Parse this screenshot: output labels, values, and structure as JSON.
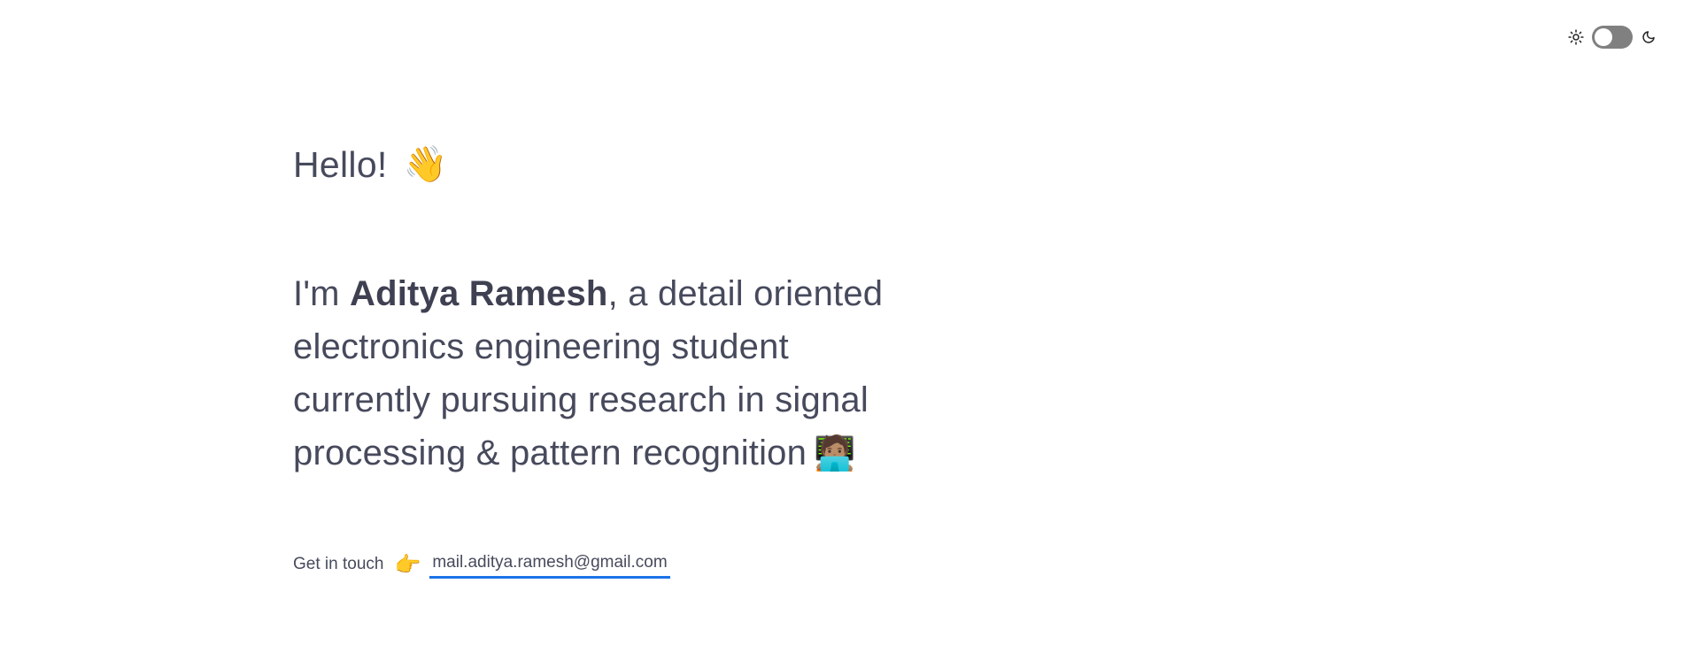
{
  "theme_toggle": {
    "light_icon": "sun-icon",
    "dark_icon": "moon-icon",
    "state": "light"
  },
  "hero": {
    "greeting": "Hello!",
    "greeting_emoji": "👋",
    "intro_prefix": "I'm ",
    "name": "Aditya Ramesh",
    "intro_suffix": ", a detail oriented electronics engineering student currently pursuing research in signal processing & pattern recognition",
    "intro_emoji": "🧑🏽‍💻"
  },
  "contact": {
    "label": "Get in touch",
    "pointer_emoji": "👉",
    "email": "mail.aditya.ramesh@gmail.com"
  },
  "colors": {
    "text": "#474a5c",
    "link_underline": "#1a73e8",
    "toggle_track": "#808080"
  }
}
